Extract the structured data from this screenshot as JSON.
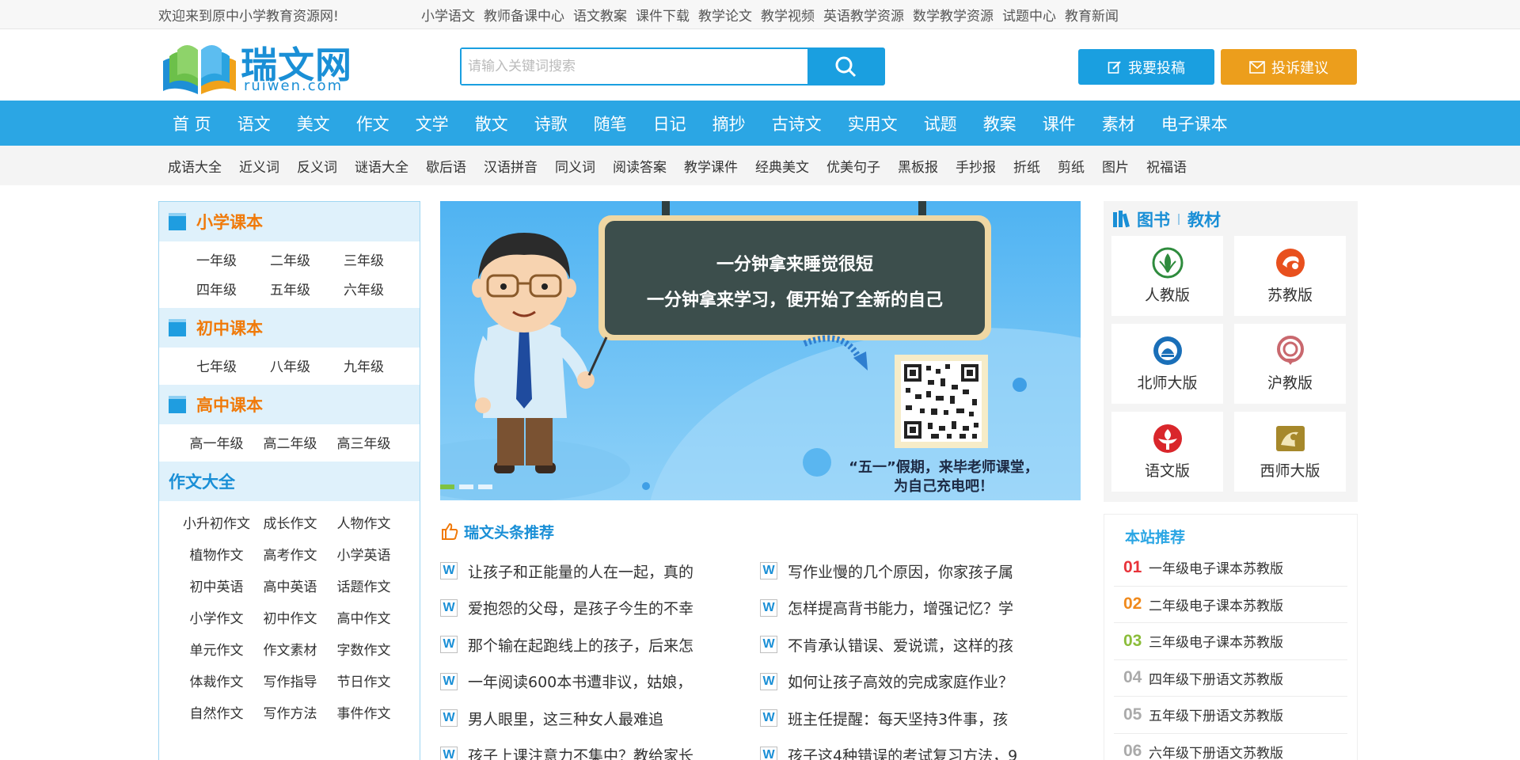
{
  "topbar": {
    "welcome": "欢迎来到原中小学教育资源网!",
    "links": [
      "小学语文",
      "教师备课中心",
      "语文教案",
      "课件下载",
      "教学论文",
      "教学视频",
      "英语教学资源",
      "数学教学资源",
      "试题中心",
      "教育新闻"
    ]
  },
  "logo": {
    "cn": "瑞文网",
    "en": "ruiwen.com"
  },
  "search": {
    "placeholder": "请输入关键词搜索",
    "icon": "search-icon"
  },
  "header_buttons": {
    "submit": "我要投稿",
    "complain": "投诉建议"
  },
  "main_nav": [
    "首 页",
    "语文",
    "美文",
    "作文",
    "文学",
    "散文",
    "诗歌",
    "随笔",
    "日记",
    "摘抄",
    "古诗文",
    "实用文",
    "试题",
    "教案",
    "课件",
    "素材",
    "电子课本"
  ],
  "sub_nav": [
    "成语大全",
    "近义词",
    "反义词",
    "谜语大全",
    "歇后语",
    "汉语拼音",
    "同义词",
    "阅读答案",
    "教学课件",
    "经典美文",
    "优美句子",
    "黑板报",
    "手抄报",
    "折纸",
    "剪纸",
    "图片",
    "祝福语"
  ],
  "left": {
    "primary": {
      "title": "小学课本",
      "items": [
        "一年级",
        "二年级",
        "三年级",
        "四年级",
        "五年级",
        "六年级"
      ]
    },
    "junior": {
      "title": "初中课本",
      "items": [
        "七年级",
        "八年级",
        "九年级"
      ]
    },
    "senior": {
      "title": "高中课本",
      "items": [
        "高一年级",
        "高二年级",
        "高三年级"
      ]
    },
    "essay": {
      "title": "作文大全",
      "items": [
        "小升初作文",
        "成长作文",
        "人物作文",
        "植物作文",
        "高考作文",
        "小学英语",
        "初中英语",
        "高中英语",
        "话题作文",
        "小学作文",
        "初中作文",
        "高中作文",
        "单元作文",
        "作文素材",
        "字数作文",
        "体裁作文",
        "写作指导",
        "节日作文",
        "自然作文",
        "写作方法",
        "事件作文"
      ]
    }
  },
  "banner": {
    "line1": "一分钟拿来睡觉很短",
    "line2": "一分钟拿来学习，便开始了全新的自己",
    "caption1": "“五一”假期，来毕老师课堂，",
    "caption2": "为自己充电吧！"
  },
  "news": {
    "title": "瑞文头条推荐",
    "badge": "W",
    "left": [
      "让孩子和正能量的人在一起，真的",
      "爱抱怨的父母，是孩子今生的不幸",
      "那个输在起跑线上的孩子，后来怎",
      "一年阅读600本书遭非议，姑娘，",
      "男人眼里，这三种女人最难追",
      "孩子上课注意力不集中？教给家长"
    ],
    "right": [
      "写作业慢的几个原因，你家孩子属",
      "怎样提高背书能力，增强记忆？学",
      "不肯承认错误、爱说谎，这样的孩",
      "如何让孩子高效的完成家庭作业？",
      "班主任提醒：每天坚持3件事，孩",
      "孩子这4种错误的考试复习方法，9"
    ]
  },
  "books": {
    "title1": "图书",
    "title2": "教材",
    "items": [
      {
        "name": "人教版",
        "color": "#2e8b3d"
      },
      {
        "name": "苏教版",
        "color": "#e8501e"
      },
      {
        "name": "北师大版",
        "color": "#1a6fb8"
      },
      {
        "name": "沪教版",
        "color": "#c9686e"
      },
      {
        "name": "语文版",
        "color": "#d9262b"
      },
      {
        "name": "西师大版",
        "color": "#a6882b"
      }
    ]
  },
  "recommend": {
    "title": "本站推荐",
    "items": [
      {
        "num": "01",
        "text": "一年级电子课本苏教版",
        "color": "#e8333a"
      },
      {
        "num": "02",
        "text": "二年级电子课本苏教版",
        "color": "#f08a1c"
      },
      {
        "num": "03",
        "text": "三年级电子课本苏教版",
        "color": "#8bbd3a"
      },
      {
        "num": "04",
        "text": "四年级下册语文苏教版",
        "color": "#aaaaaa"
      },
      {
        "num": "05",
        "text": "五年级下册语文苏教版",
        "color": "#aaaaaa"
      },
      {
        "num": "06",
        "text": "六年级下册语文苏教版",
        "color": "#aaaaaa"
      }
    ]
  }
}
